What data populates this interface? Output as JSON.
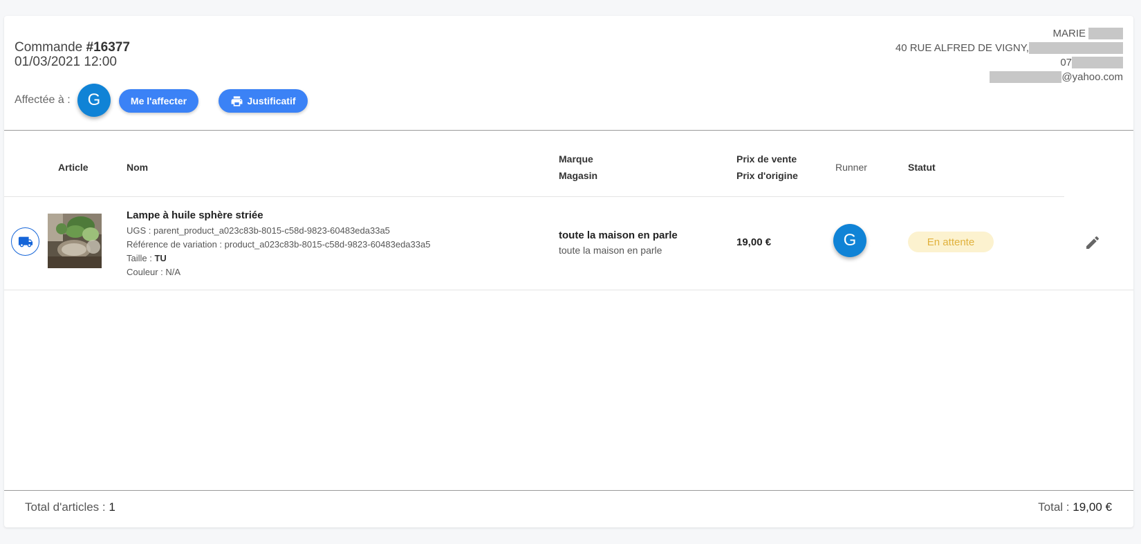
{
  "order": {
    "title_prefix": "Commande ",
    "number": "#16377",
    "datetime": "01/03/2021 12:00",
    "assigned_label": "Affectée à :",
    "assigned_initial": "G",
    "assign_me_label": "Me l'affecter",
    "receipt_label": "Justificatif"
  },
  "customer": {
    "name": "MARIE",
    "address": "40 RUE ALFRED DE VIGNY,",
    "phone_visible": "07",
    "email_domain": "@yahoo.com"
  },
  "table": {
    "headers": {
      "article": "Article",
      "nom": "Nom",
      "marque": "Marque",
      "magasin": "Magasin",
      "prix_vente": "Prix de vente",
      "prix_origine": "Prix d'origine",
      "runner": "Runner",
      "statut": "Statut"
    },
    "rows": [
      {
        "name": "Lampe à huile sphère striée",
        "ugs_label": "UGS : ",
        "ugs": "parent_product_a023c83b-8015-c58d-9823-60483eda33a5",
        "variation_label": "Référence de variation : ",
        "variation": "product_a023c83b-8015-c58d-9823-60483eda33a5",
        "size_label": "Taille : ",
        "size": "TU",
        "color_label": "Couleur : ",
        "color": "N/A",
        "brand": "toute la maison en parle",
        "store": "toute la maison en parle",
        "price": "19,00 €",
        "runner_initial": "G",
        "status": "En attente",
        "icon": "truck-icon"
      }
    ]
  },
  "footer": {
    "total_items_label": "Total d'articles : ",
    "total_items": "1",
    "total_label": "Total : ",
    "total": "19,00 €"
  },
  "colors": {
    "accent": "#3b82f6",
    "avatar": "#1083d6",
    "status_bg": "#fcf2cf",
    "status_text": "#e0b13c",
    "truck": "#1565d8"
  }
}
